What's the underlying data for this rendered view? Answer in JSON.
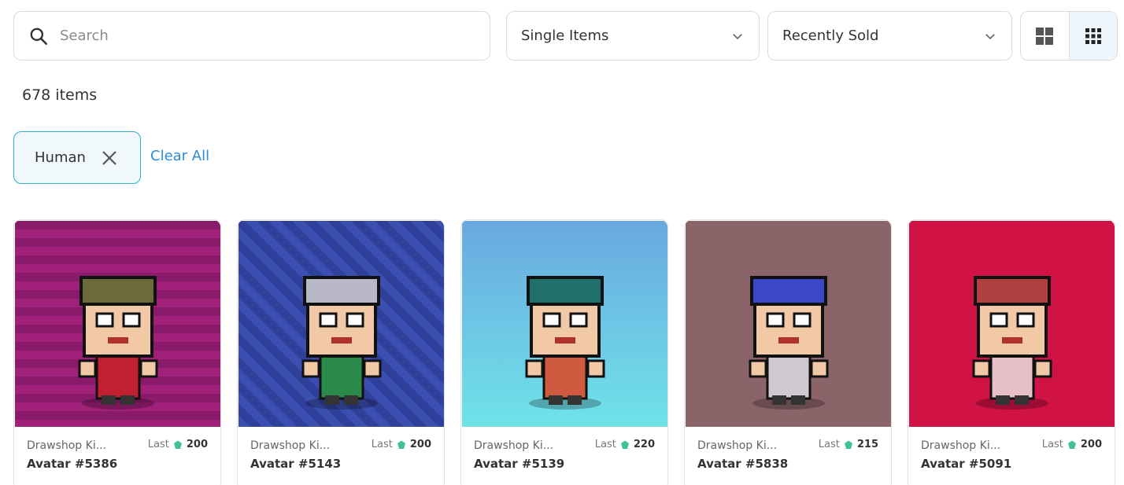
{
  "search": {
    "placeholder": "Search",
    "value": ""
  },
  "filters": {
    "type_select": {
      "selected": "Single Items"
    },
    "sort_select": {
      "selected": "Recently Sold"
    },
    "view_modes": [
      "large-grid",
      "small-grid"
    ],
    "active_view": "small-grid"
  },
  "results": {
    "count_label": "678 items"
  },
  "active_filters": [
    {
      "label": "Human"
    }
  ],
  "clear_all_label": "Clear All",
  "colors": {
    "accent": "#2e8bd8",
    "chip_border": "#2bb0c4",
    "gem": "#3fbf9a"
  },
  "cards": [
    {
      "collection": "Drawshop Ki...",
      "name": "Avatar #5386",
      "price_label": "Last",
      "price": "200",
      "bg": "#a0207a",
      "bg_alt": "#8a1a6a",
      "pattern": "stripes-h"
    },
    {
      "collection": "Drawshop Ki...",
      "name": "Avatar #5143",
      "price_label": "Last",
      "price": "200",
      "bg": "#2f3f9a",
      "bg_alt": "#3a4fb0",
      "pattern": "stripes-d"
    },
    {
      "collection": "Drawshop Ki...",
      "name": "Avatar #5139",
      "price_label": "Last",
      "price": "220",
      "bg": "#6aa8e0",
      "bg_alt": "#6fe3e8",
      "pattern": "gradient"
    },
    {
      "collection": "Drawshop Ki...",
      "name": "Avatar #5838",
      "price_label": "Last",
      "price": "215",
      "bg": "#8a6468",
      "bg_alt": "#8a6468",
      "pattern": "solid"
    },
    {
      "collection": "Drawshop Ki...",
      "name": "Avatar #5091",
      "price_label": "Last",
      "price": "200",
      "bg": "#d01244",
      "bg_alt": "#d01244",
      "pattern": "solid"
    }
  ]
}
